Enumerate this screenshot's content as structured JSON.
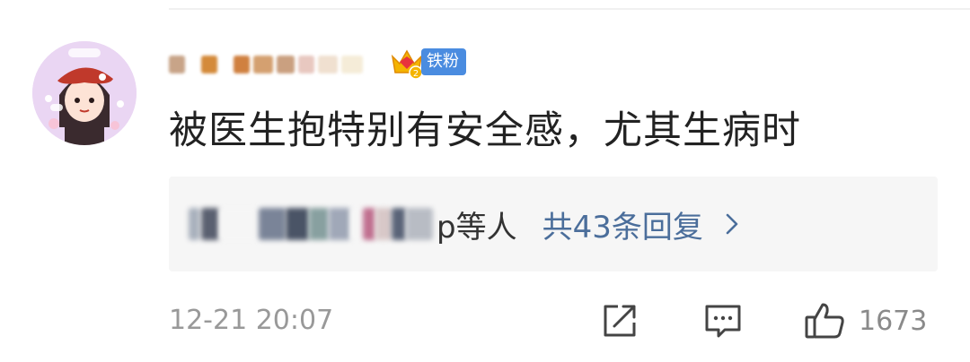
{
  "comment": {
    "username": "",
    "badge_label": "铁粉",
    "badge_level": "2",
    "text": "被医生抱特别有安全感，尤其生病时",
    "timestamp": "12-21 20:07"
  },
  "replies": {
    "names": "",
    "names_suffix": "p等人",
    "count_label": "共43条回复"
  },
  "actions": {
    "forward_icon": "share-icon",
    "comment_icon": "comment-icon",
    "like_icon": "thumbs-up-icon",
    "like_count": "1673"
  },
  "colors": {
    "link": "#4b6e9b",
    "badge_blue": "#4a8ce0",
    "badge_gold": "#f4b400",
    "text_primary": "#222222",
    "text_secondary": "#999999"
  }
}
